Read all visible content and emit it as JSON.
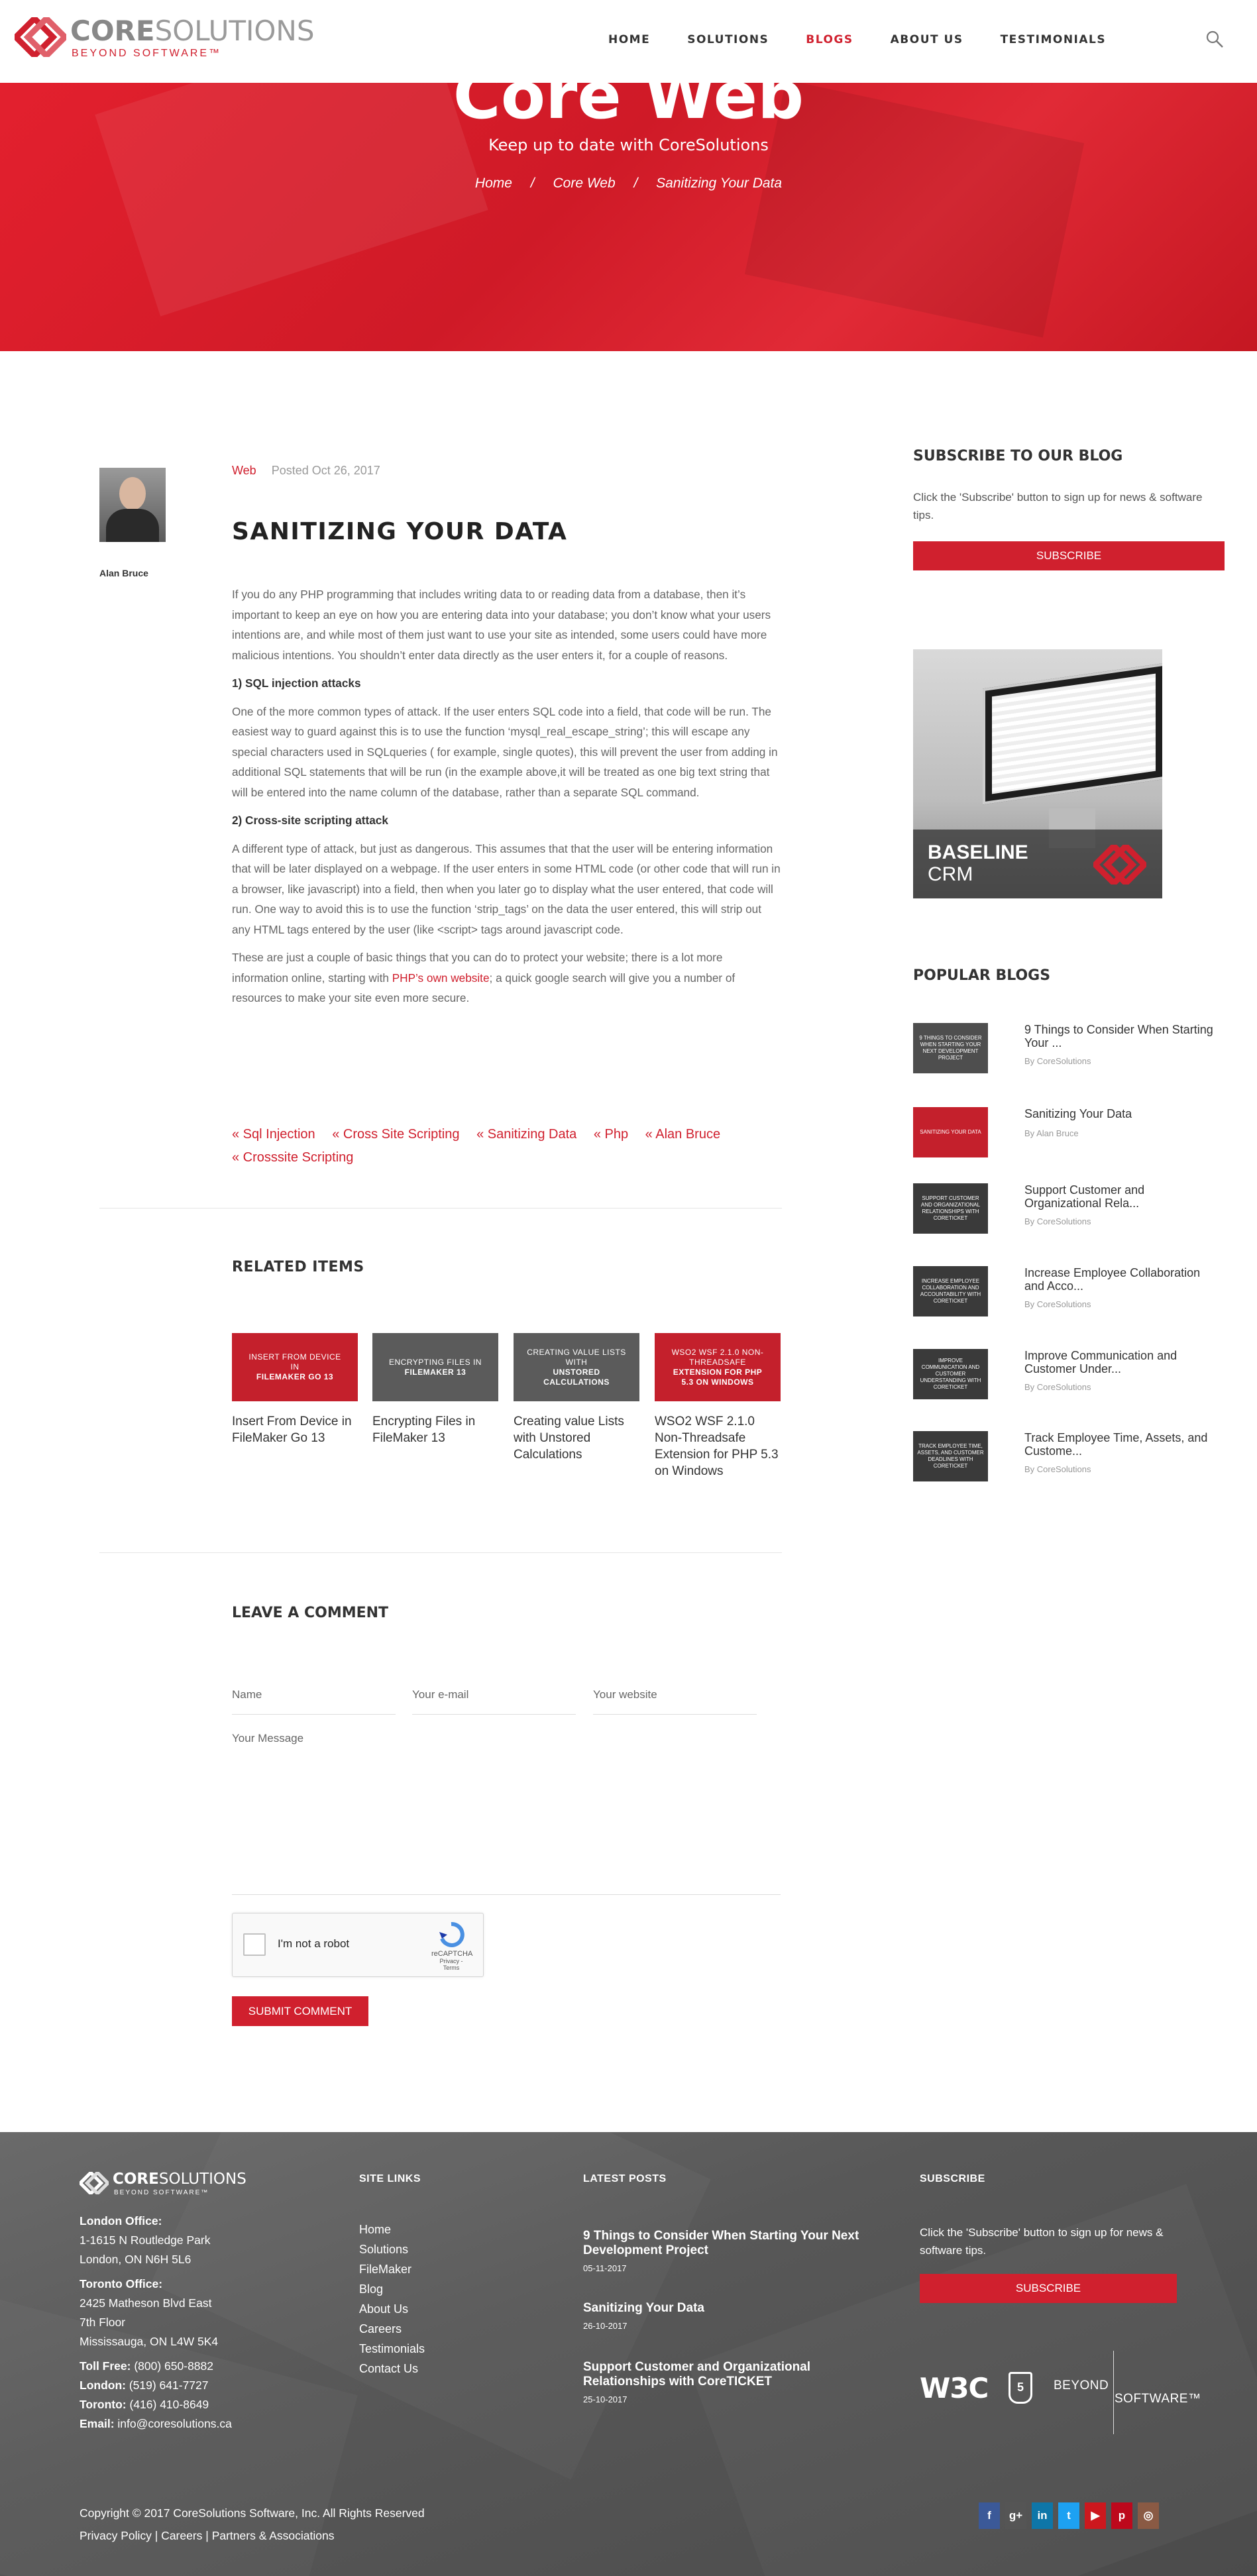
{
  "brand": {
    "name_bold": "CORE",
    "name_light": "SOLUTIONS",
    "tagline": "BEYOND SOFTWARE™",
    "accent": "#d0202e"
  },
  "nav": {
    "items": [
      "HOME",
      "SOLUTIONS",
      "BLOGS",
      "ABOUT US",
      "TESTIMONIALS"
    ],
    "active": "BLOGS"
  },
  "hero": {
    "title": "Core Web",
    "subtitle": "Keep up to date with CoreSolutions",
    "breadcrumb": [
      "Home",
      "Core Web",
      "Sanitizing Your Data"
    ],
    "separator": "/"
  },
  "author": {
    "name": "Alan Bruce"
  },
  "post": {
    "category": "Web",
    "date": "Posted Oct 26, 2017",
    "title": "SANITIZING YOUR DATA",
    "p1": "If you do any PHP programming that includes writing data to or reading data from a database, then it’s important to keep an eye on how you are entering data into your database; you don’t know what your users intentions are, and while most of them just want to use your site as intended, some users could have more malicious intentions. You shouldn’t enter data directly as the user enters it, for a couple of reasons.",
    "h1": "1) SQL injection attacks",
    "p2": "One of the more common types of attack. If the user enters SQL code into a field, that code will be run. The easiest way to guard against this is to use the function ‘mysql_real_escape_string’; this will escape any special characters used in SQLqueries ( for example, single quotes), this will prevent the user from adding in additional SQL statements that will be run (in the example above,it will be treated as one big text string that will be entered into the name column of the database, rather than a separate SQL command.",
    "h2": "2) Cross-site scripting attack",
    "p3": "A different type of attack, but just as dangerous. This assumes that that the user will be entering information that will be later displayed on a webpage. If the user enters in some HTML code (or other code that will run in a browser, like javascript) into a field, then when you later go to display what the user entered, that code will run. One way to avoid this is to use the function ‘strip_tags’ on the data the user entered, this will strip out any HTML tags entered by the user (like <script> tags around javascript code.",
    "p4_a": "These are just a couple of basic things that you can do to protect your website; there is a lot more information online, starting with ",
    "p4_link": "PHP’s own website",
    "p4_b": "; a quick google search will give you a number of resources to make your site even more secure.",
    "tags": [
      "« Sql Injection",
      "« Cross Site Scripting",
      "« Sanitizing Data",
      "« Php",
      "« Alan Bruce",
      "« Crosssite Scripting"
    ]
  },
  "related": {
    "title": "RELATED ITEMS",
    "items": [
      {
        "thumb_top": "INSERT FROM DEVICE IN",
        "thumb_bold": "FILEMAKER GO 13",
        "title": "Insert From Device in FileMaker Go 13",
        "color": "#c4202c"
      },
      {
        "thumb_top": "ENCRYPTING FILES IN",
        "thumb_bold": "FILEMAKER 13",
        "title": "Encrypting Files in FileMaker 13",
        "color": "#5b5b5b"
      },
      {
        "thumb_top": "CREATING VALUE LISTS WITH",
        "thumb_bold": "UNSTORED CALCULATIONS",
        "title": "Creating value Lists with Unstored Calculations",
        "color": "#5b5b5b"
      },
      {
        "thumb_top": "WSO2 WSF 2.1.0 NON-THREADSAFE",
        "thumb_bold": "EXTENSION FOR PHP 5.3 ON WINDOWS",
        "title": "WSO2 WSF 2.1.0 Non-Threadsafe Extension for PHP 5.3 on Windows",
        "color": "#c4202c"
      }
    ]
  },
  "comment": {
    "title": "LEAVE A COMMENT",
    "name_ph": "Name",
    "email_ph": "Your e-mail",
    "website_ph": "Your website",
    "message_ph": "Your Message",
    "captcha_label": "I'm not a robot",
    "captcha_brand": "reCAPTCHA",
    "captcha_links": "Privacy - Terms",
    "submit": "SUBMIT COMMENT"
  },
  "sidebar": {
    "subscribe_title": "SUBSCRIBE TO OUR BLOG",
    "subscribe_text": "Click the 'Subscribe' button to sign up for news & software tips.",
    "subscribe_btn": "SUBSCRIBE",
    "ad_line1": "BASELINE",
    "ad_line2": "CRM",
    "popular_title": "POPULAR BLOGS",
    "popular": [
      {
        "thumb": "9 THINGS TO CONSIDER WHEN STARTING YOUR NEXT DEVELOPMENT PROJECT",
        "title": "9 Things to Consider When Starting Your ...",
        "by": "By CoreSolutions",
        "color": "#4e4e4e"
      },
      {
        "thumb": "SANITIZING YOUR DATA",
        "title": "Sanitizing Your Data",
        "by": "By Alan Bruce",
        "color": "#c4202c"
      },
      {
        "thumb": "SUPPORT CUSTOMER AND ORGANIZATIONAL RELATIONSHIPS WITH CORETICKET",
        "title": "Support Customer and Organizational Rela...",
        "by": "By CoreSolutions",
        "color": "#3a3a3a"
      },
      {
        "thumb": "INCREASE EMPLOYEE COLLABORATION AND ACCOUNTABILITY WITH CORETICKET",
        "title": "Increase Employee Collaboration and Acco...",
        "by": "By CoreSolutions",
        "color": "#3a3a3a"
      },
      {
        "thumb": "IMPROVE COMMUNICATION AND CUSTOMER UNDERSTANDING WITH CORETICKET",
        "title": "Improve Communication and Customer Under...",
        "by": "By CoreSolutions",
        "color": "#3a3a3a"
      },
      {
        "thumb": "TRACK EMPLOYEE TIME, ASSETS, AND CUSTOMER DEADLINES WITH CORETICKET",
        "title": "Track Employee Time, Assets, and Custome...",
        "by": "By CoreSolutions",
        "color": "#3a3a3a"
      }
    ]
  },
  "footer": {
    "logo_bold": "CORE",
    "logo_light": "SOLUTIONS",
    "logo_tag": "BEYOND SOFTWARE™",
    "london_label": "London Office:",
    "london_1": "1-1615 N Routledge Park",
    "london_2": "London, ON N6H 5L6",
    "toronto_label": "Toronto Office:",
    "toronto_1": "2425 Matheson Blvd East",
    "toronto_2": "7th Floor",
    "toronto_3": "Mississauga, ON L4W 5K4",
    "tollfree_label": "Toll Free:",
    "tollfree": " (800) 650-8882",
    "london_ph_label": "London:",
    "london_ph": " (519) 641-7727",
    "toronto_ph_label": "Toronto:",
    "toronto_ph": " (416) 410-8649",
    "email_label": "Email:",
    "email": " info@coresolutions.ca",
    "sitelinks_title": "SITE LINKS",
    "sitelinks": [
      "Home",
      "Solutions",
      "FileMaker",
      "Blog",
      "About Us",
      "Careers",
      "Testimonials",
      "Contact Us"
    ],
    "latest_title": "LATEST POSTS",
    "latest": [
      {
        "title": "9 Things to Consider When Starting Your Next Development Project",
        "date": "05-11-2017"
      },
      {
        "title": "Sanitizing Your Data",
        "date": "26-10-2017"
      },
      {
        "title": "Support Customer and Organizational Relationships with CoreTICKET",
        "date": "25-10-2017"
      }
    ],
    "subscribe_title": "SUBSCRIBE",
    "subscribe_text": "Click the 'Subscribe' button to sign up for news & software tips.",
    "subscribe_btn": "SUBSCRIBE",
    "w3c": "W3C",
    "html5": "5",
    "beyond": "BEYOND",
    "software": "SOFTWARE™",
    "copyright": "Copyright © 2017 CoreSolutions Software, Inc. All Rights Reserved",
    "policy": "Privacy Policy | Careers | Partners & Associations",
    "social": [
      {
        "icon": "facebook-icon",
        "glyph": "f",
        "color": "#3b5998"
      },
      {
        "icon": "googleplus-icon",
        "glyph": "g+",
        "color": "#555555"
      },
      {
        "icon": "linkedin-icon",
        "glyph": "in",
        "color": "#0e76a8"
      },
      {
        "icon": "twitter-icon",
        "glyph": "t",
        "color": "#1da1f2"
      },
      {
        "icon": "youtube-icon",
        "glyph": "▶",
        "color": "#cc181e"
      },
      {
        "icon": "pinterest-icon",
        "glyph": "p",
        "color": "#bd081c"
      },
      {
        "icon": "instagram-icon",
        "glyph": "◎",
        "color": "#8a5a44"
      }
    ]
  }
}
